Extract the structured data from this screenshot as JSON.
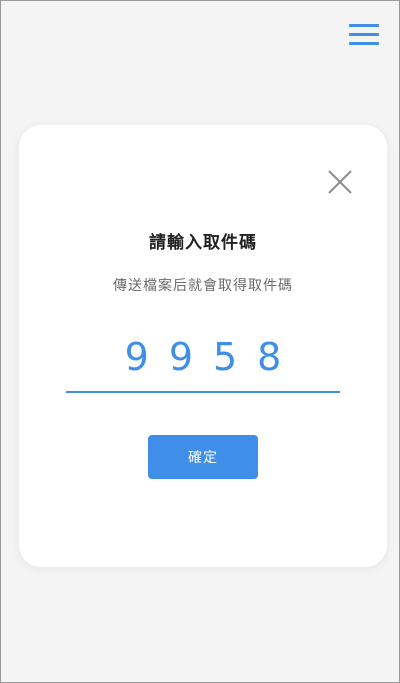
{
  "header": {
    "menu_icon": "hamburger-menu-icon"
  },
  "dialog": {
    "close_icon": "close-icon",
    "title": "請輸入取件碼",
    "subtitle": "傳送檔案后就會取得取件碼",
    "code_value": "9958",
    "confirm_label": "確定"
  },
  "colors": {
    "accent": "#3f8fe8",
    "background": "#f4f4f5",
    "card": "#ffffff"
  }
}
